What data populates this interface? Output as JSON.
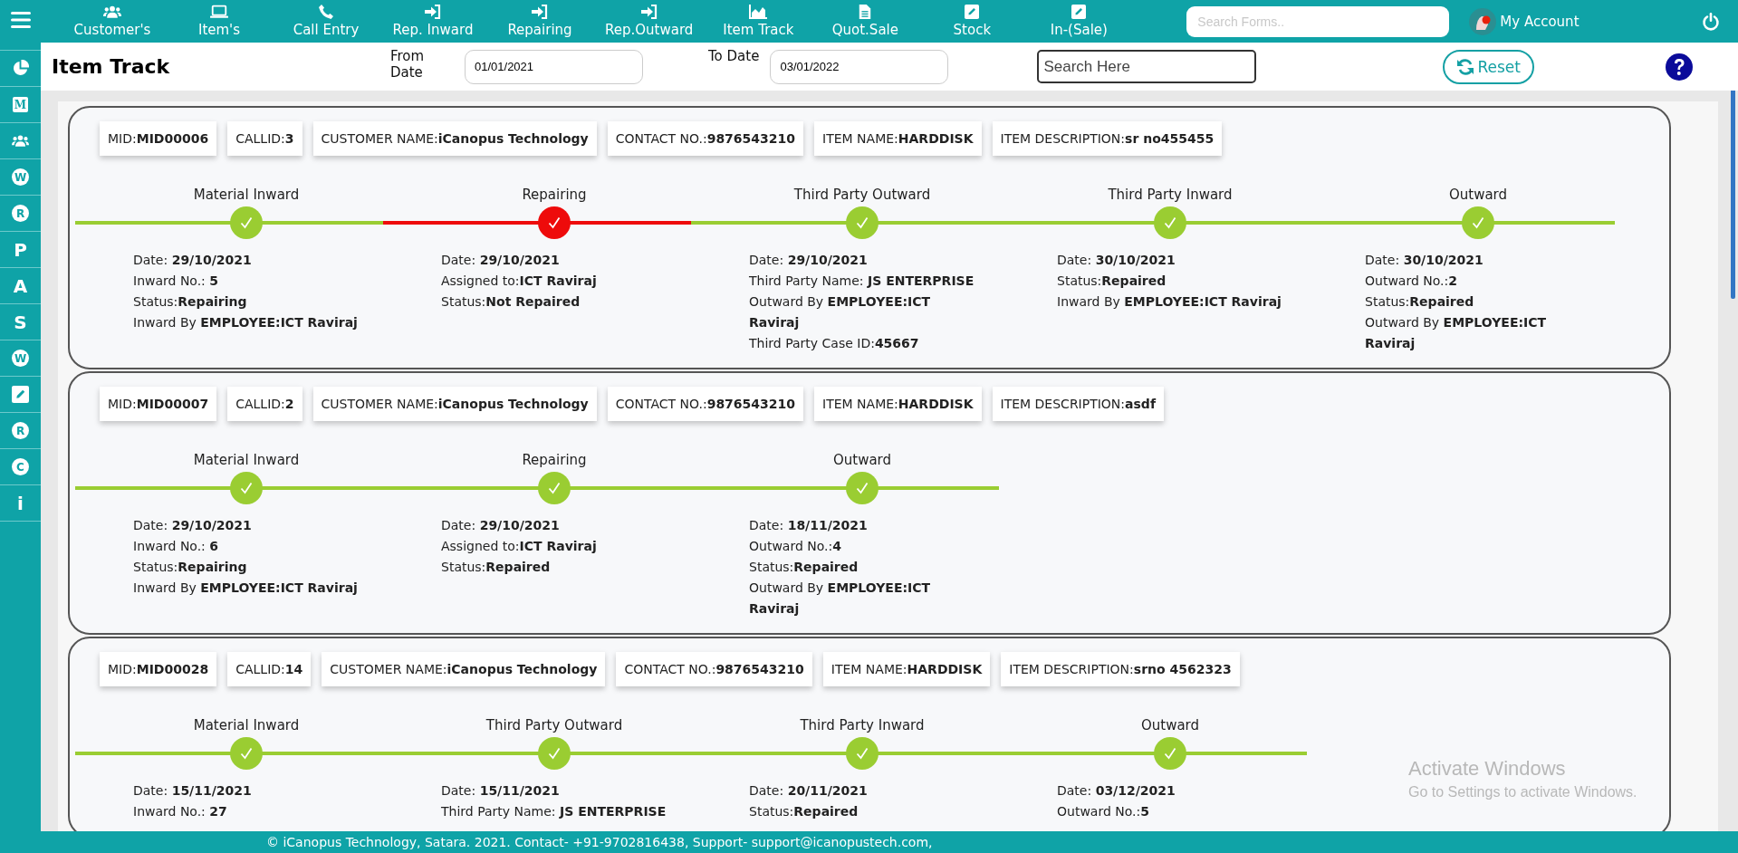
{
  "sidebar": {
    "items": [
      {
        "kind": "pie"
      },
      {
        "kind": "letter-box",
        "glyph": "M"
      },
      {
        "kind": "users"
      },
      {
        "kind": "letter-circle",
        "glyph": "W"
      },
      {
        "kind": "letter-circle",
        "glyph": "R"
      },
      {
        "kind": "letter",
        "glyph": "P"
      },
      {
        "kind": "letter",
        "glyph": "A"
      },
      {
        "kind": "letter",
        "glyph": "S"
      },
      {
        "kind": "letter-circle",
        "glyph": "W"
      },
      {
        "kind": "edit"
      },
      {
        "kind": "letter-circle",
        "glyph": "R"
      },
      {
        "kind": "letter-circle",
        "glyph": "C"
      },
      {
        "kind": "letter",
        "glyph": "i"
      }
    ]
  },
  "nav": [
    {
      "label": "Customer's",
      "kind": "users"
    },
    {
      "label": "Item's",
      "kind": "laptop"
    },
    {
      "label": "Call Entry",
      "kind": "phone"
    },
    {
      "label": "Rep. Inward",
      "kind": "sign-in"
    },
    {
      "label": "Repairing",
      "kind": "sign-in"
    },
    {
      "label": "Rep.Outward",
      "kind": "sign-in"
    },
    {
      "label": "Item Track",
      "kind": "chart"
    },
    {
      "label": "Quot.Sale",
      "kind": "file"
    },
    {
      "label": "Stock",
      "kind": "edit"
    },
    {
      "label": "In-(Sale)",
      "kind": "edit"
    }
  ],
  "search_forms": {
    "placeholder": "Search Forms.."
  },
  "account": {
    "label": "My Account"
  },
  "header": {
    "title": "Item Track",
    "from_label": "From Date",
    "from_value": "01/01/2021",
    "to_label": "To Date",
    "to_value": "03/01/2022",
    "search_placeholder": "Search Here",
    "reset": "Reset"
  },
  "cards": [
    {
      "chips": [
        "MID:**MID00006**",
        "CALLID:**3**",
        "CUSTOMER NAME:**iCanopus Technology**",
        "CONTACT NO.:**9876543210**",
        "ITEM NAME:**HARDDISK**",
        "ITEM DESCRIPTION:**sr no455455**"
      ],
      "steps": [
        {
          "label": "Material Inward",
          "kind": "done",
          "details": [
            "Date: **29/10/2021**",
            "Inward No.: **5**",
            "Status:**Repairing**",
            "Inward By **EMPLOYEE:ICT Raviraj**"
          ]
        },
        {
          "label": "Repairing",
          "kind": "failed",
          "details": [
            "Date: **29/10/2021**",
            "Assigned to:**ICT Raviraj**",
            "Status:**Not Repaired**"
          ]
        },
        {
          "label": "Third Party Outward",
          "kind": "done",
          "details": [
            "Date: **29/10/2021**",
            "Third Party Name: **JS ENTERPRISE**",
            "Outward By **EMPLOYEE:ICT Raviraj**",
            "Third Party Case ID:**45667**"
          ]
        },
        {
          "label": "Third Party Inward",
          "kind": "done",
          "details": [
            "Date: **30/10/2021**",
            "Status:**Repaired**",
            "Inward By **EMPLOYEE:ICT Raviraj**"
          ]
        },
        {
          "label": "Outward",
          "kind": "done",
          "details": [
            "Date: **30/10/2021**",
            "Outward No.:**2**",
            "Status:**Repaired**",
            "Outward By **EMPLOYEE:ICT Raviraj**"
          ]
        }
      ]
    },
    {
      "chips": [
        "MID:**MID00007**",
        "CALLID:**2**",
        "CUSTOMER NAME:**iCanopus Technology**",
        "CONTACT NO.:**9876543210**",
        "ITEM NAME:**HARDDISK**",
        "ITEM DESCRIPTION:**asdf**"
      ],
      "steps": [
        {
          "label": "Material Inward",
          "kind": "done",
          "details": [
            "Date: **29/10/2021**",
            "Inward No.: **6**",
            "Status:**Repairing**",
            "Inward By **EMPLOYEE:ICT Raviraj**"
          ]
        },
        {
          "label": "Repairing",
          "kind": "done",
          "details": [
            "Date: **29/10/2021**",
            "Assigned to:**ICT Raviraj**",
            "Status:**Repaired**"
          ]
        },
        {
          "label": "Outward",
          "kind": "done",
          "details": [
            "Date: **18/11/2021**",
            "Outward No.:**4**",
            "Status:**Repaired**",
            "Outward By **EMPLOYEE:ICT Raviraj**"
          ]
        }
      ]
    },
    {
      "chips": [
        "MID:**MID00028**",
        "CALLID:**14**",
        "CUSTOMER NAME:**iCanopus Technology**",
        "CONTACT NO.:**9876543210**",
        "ITEM NAME:**HARDDISK**",
        "ITEM DESCRIPTION:**srno 4562323**"
      ],
      "steps": [
        {
          "label": "Material Inward",
          "kind": "done",
          "details": [
            "Date: **15/11/2021**",
            "Inward No.: **27**"
          ]
        },
        {
          "label": "Third Party Outward",
          "kind": "done",
          "details": [
            "Date: **15/11/2021**",
            "Third Party Name: **JS ENTERPRISE**"
          ]
        },
        {
          "label": "Third Party Inward",
          "kind": "done",
          "details": [
            "Date: **20/11/2021**",
            "Status:**Repaired**"
          ]
        },
        {
          "label": "Outward",
          "kind": "done",
          "details": [
            "Date: **03/12/2021**",
            "Outward No.:**5**"
          ]
        }
      ]
    }
  ],
  "footer": "© iCanopus Technology, Satara. 2021. Contact- +91-9702816438, Support- support@icanopustech.com,",
  "os_notice": {
    "title": "Activate Windows",
    "text": "Go to Settings to activate Windows."
  }
}
